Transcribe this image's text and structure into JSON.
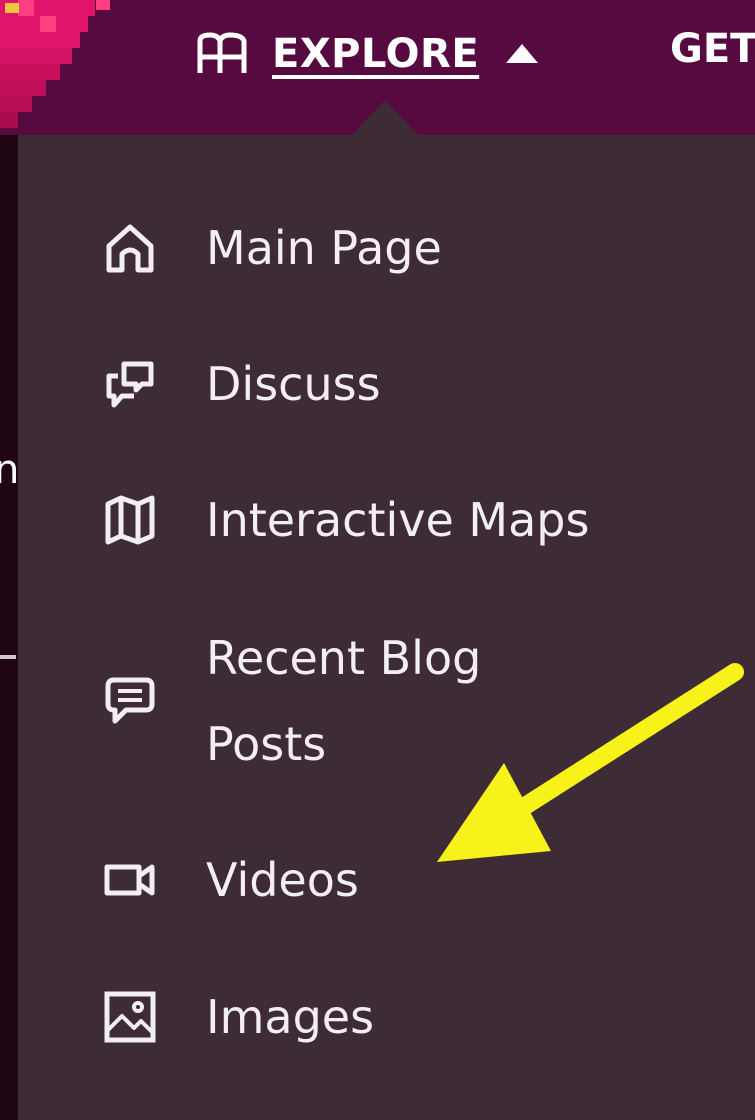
{
  "nav": {
    "explore_label": "EXPLORE",
    "next_label": "GET"
  },
  "menu": {
    "items": [
      {
        "label": "Main Page",
        "icon": "home-icon"
      },
      {
        "label": "Discuss",
        "icon": "discuss-icon"
      },
      {
        "label": "Interactive Maps",
        "icon": "map-icon"
      },
      {
        "label": "Recent Blog Posts",
        "icon": "blog-comment-icon"
      },
      {
        "label": "Videos",
        "icon": "video-camera-icon"
      },
      {
        "label": "Images",
        "icon": "image-icon"
      }
    ]
  },
  "colors": {
    "nav_background": "#560a40",
    "dropdown_background": "#3d2b36",
    "menu_text": "#f3eef1",
    "annotation_arrow": "#f7f21a"
  }
}
